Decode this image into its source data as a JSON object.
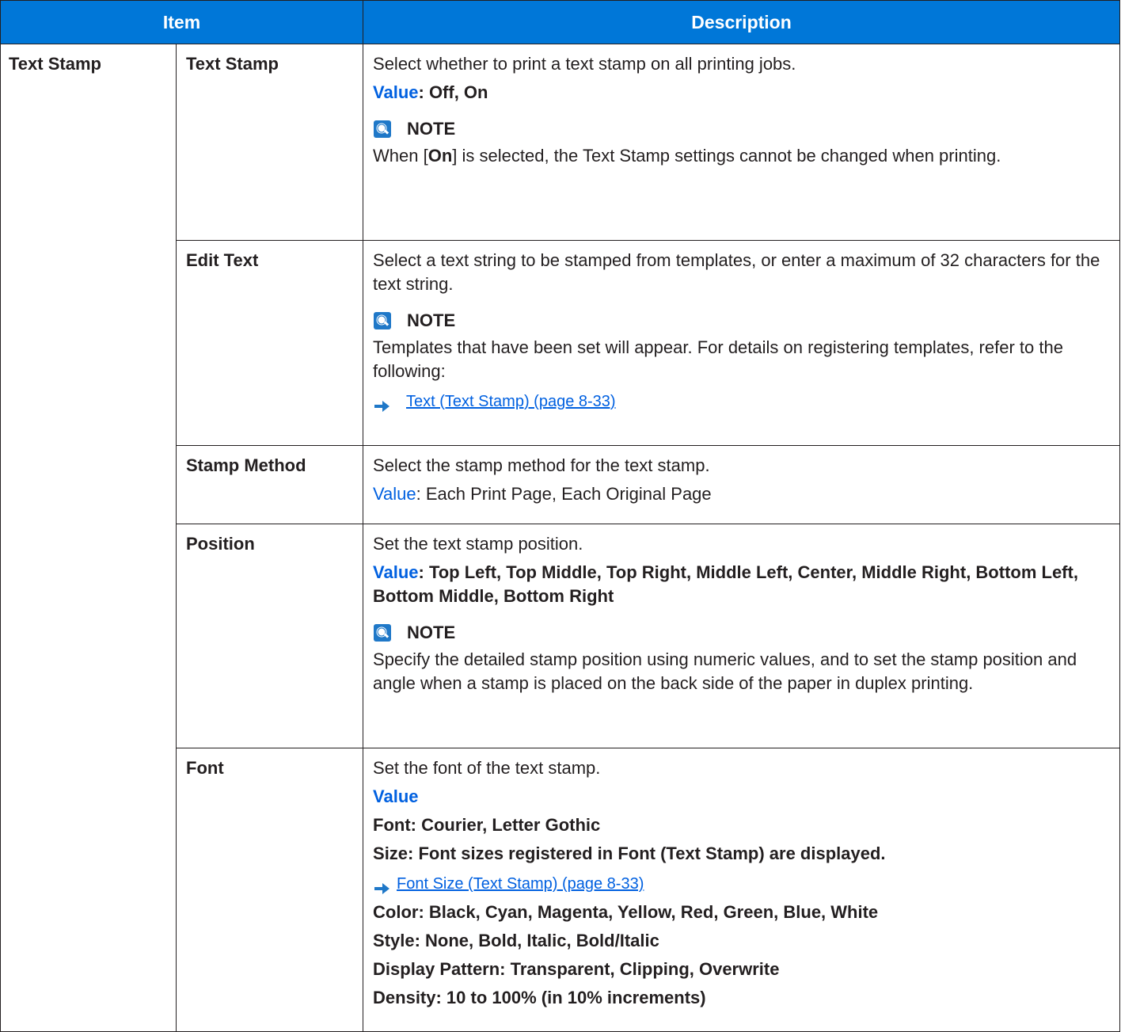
{
  "colors": {
    "header_bg": "#0077d8",
    "accent": "#0060e0",
    "note_icon": "#1f78c8",
    "border": "#231f20"
  },
  "table": {
    "col_item": "Item",
    "col_description": "Description",
    "group": "Text Stamp"
  },
  "rows": {
    "text_stamp": {
      "name": "Text Stamp",
      "desc": "Select whether to print a text stamp on all printing jobs.",
      "value_label": "Value",
      "value_text": ": Off, On",
      "note_title": "NOTE",
      "note_pre": "When [",
      "note_bold": "On",
      "note_post": "] is selected, the Text Stamp settings cannot be changed when printing."
    },
    "edit_text": {
      "name": "Edit Text",
      "desc": "Select a text string to be stamped from templates, or enter a maximum of 32 characters for the text string.",
      "note_title": "NOTE",
      "note_text": "Templates that have been set will appear. For details on registering templates, refer to the following:",
      "link_icon": "right-arrow-icon",
      "link_text": "Text (Text Stamp) (page 8-33)"
    },
    "stamp_method": {
      "name": "Stamp Method",
      "desc": "Select the stamp method for the text stamp.",
      "value_label": "Value",
      "value_text": ": Each Print Page, Each Original Page"
    },
    "position": {
      "name": "Position",
      "desc": "Set the text stamp position.",
      "value_label": "Value",
      "value_text": ": Top Left, Top Middle, Top Right, Middle Left, Center, Middle Right, Bottom Left, Bottom Middle, Bottom Right",
      "note_title": "NOTE",
      "note_text": "Specify the detailed stamp position using numeric values, and to set the stamp position and angle when a stamp is placed on the back side of the paper in duplex printing."
    },
    "font": {
      "name": "Font",
      "desc": "Set the font of the text stamp.",
      "value_label": "Value",
      "font_line": "Font: Courier, Letter Gothic",
      "size_line": "Size: Font sizes registered in Font (Text Stamp) are displayed.",
      "link_icon": "right-arrow-icon",
      "link_text": "Font Size (Text Stamp) (page 8-33)",
      "color_line": "Color: Black, Cyan, Magenta, Yellow, Red, Green, Blue, White",
      "style_line": "Style: None, Bold, Italic, Bold/Italic",
      "pattern_line": "Display Pattern: Transparent, Clipping, Overwrite",
      "density_line": "Density: 10 to 100% (in 10% increments)"
    }
  }
}
